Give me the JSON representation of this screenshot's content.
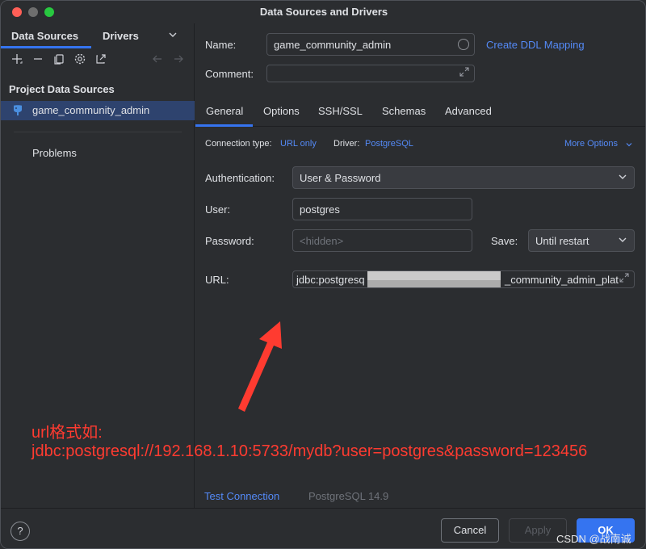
{
  "window": {
    "title": "Data Sources and Drivers"
  },
  "left": {
    "tabs": [
      "Data Sources",
      "Drivers"
    ],
    "section_title": "Project Data Sources",
    "selected_item": "game_community_admin",
    "problems_label": "Problems",
    "toolbar_icons": [
      "add-icon",
      "remove-icon",
      "copy-icon",
      "settings-icon",
      "export-icon",
      "back-icon",
      "forward-icon"
    ]
  },
  "form": {
    "name_label": "Name:",
    "name_value": "game_community_admin",
    "ddl_link": "Create DDL Mapping",
    "comment_label": "Comment:",
    "comment_value": ""
  },
  "tabs": [
    "General",
    "Options",
    "SSH/SSL",
    "Schemas",
    "Advanced"
  ],
  "general": {
    "conn_type_label": "Connection type:",
    "conn_type_value": "URL only",
    "driver_label": "Driver:",
    "driver_value": "PostgreSQL",
    "more_options": "More Options",
    "auth_label": "Authentication:",
    "auth_value": "User & Password",
    "user_label": "User:",
    "user_value": "postgres",
    "password_label": "Password:",
    "password_placeholder": "<hidden>",
    "save_label": "Save:",
    "save_value": "Until restart",
    "url_label": "URL:",
    "url_value_start": "jdbc:postgresq",
    "url_value_end": "_community_admin_plat"
  },
  "annotation": {
    "line1": "url格式如:",
    "line2": "jdbc:postgresql://192.168.1.10:5733/mydb?user=postgres&password=123456",
    "color": "#ff3b30"
  },
  "footer": {
    "test_connection": "Test Connection",
    "driver_version": "PostgreSQL 14.9"
  },
  "buttons": {
    "help": "?",
    "cancel": "Cancel",
    "apply": "Apply",
    "ok": "OK"
  },
  "watermark": "CSDN @战南诚",
  "colors": {
    "accent": "#3574f0",
    "link": "#548af7",
    "background": "#2b2d30"
  }
}
